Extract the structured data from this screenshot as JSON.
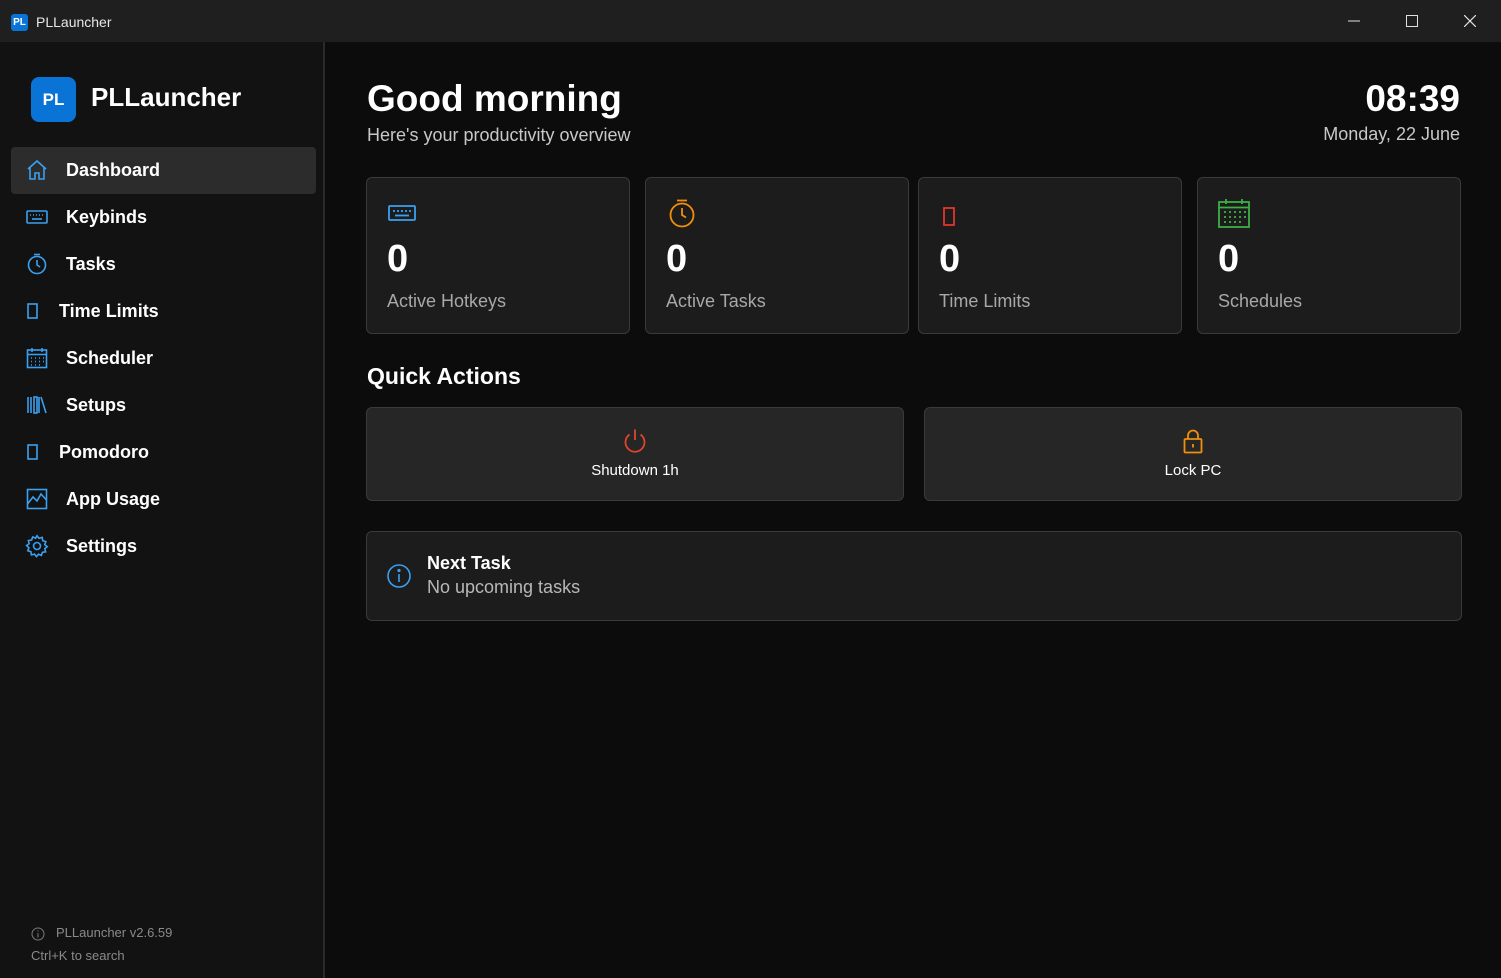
{
  "window": {
    "badge": "PL",
    "title": "PLLauncher"
  },
  "sidebar": {
    "logo_text": "PL",
    "brand": "PLLauncher",
    "items": [
      {
        "label": "Dashboard",
        "icon": "home-icon",
        "active": true
      },
      {
        "label": "Keybinds",
        "icon": "keyboard-icon"
      },
      {
        "label": "Tasks",
        "icon": "timer-icon"
      },
      {
        "label": "Time Limits",
        "icon": "rectangle-icon"
      },
      {
        "label": "Scheduler",
        "icon": "calendar-icon"
      },
      {
        "label": "Setups",
        "icon": "library-icon"
      },
      {
        "label": "Pomodoro",
        "icon": "rectangle-icon"
      },
      {
        "label": "App Usage",
        "icon": "chart-icon"
      },
      {
        "label": "Settings",
        "icon": "gear-icon"
      }
    ],
    "version": "PLLauncher v2.6.59",
    "hint": "Ctrl+K to search"
  },
  "header": {
    "greeting": "Good morning",
    "subtitle": "Here's your productivity overview",
    "time": "08:39",
    "date": "Monday, 22 June"
  },
  "stats": [
    {
      "value": "0",
      "label": "Active Hotkeys",
      "icon": "keyboard-icon",
      "color": "#3aa0f0"
    },
    {
      "value": "0",
      "label": "Active Tasks",
      "icon": "timer-icon",
      "color": "#f0900a"
    },
    {
      "value": "0",
      "label": "Time Limits",
      "icon": "rectangle-icon",
      "color": "#e0362b"
    },
    {
      "value": "0",
      "label": "Schedules",
      "icon": "calendar-icon",
      "color": "#3cb043"
    }
  ],
  "quick_actions": {
    "title": "Quick Actions",
    "buttons": [
      {
        "label": "Shutdown 1h",
        "icon": "power-icon",
        "color": "#e0452b"
      },
      {
        "label": "Lock PC",
        "icon": "lock-icon",
        "color": "#f0900a"
      }
    ]
  },
  "next_task": {
    "title": "Next Task",
    "subtitle": "No upcoming tasks"
  },
  "colors": {
    "accent": "#0a74d6",
    "icon_blue": "#3aa0f0"
  }
}
